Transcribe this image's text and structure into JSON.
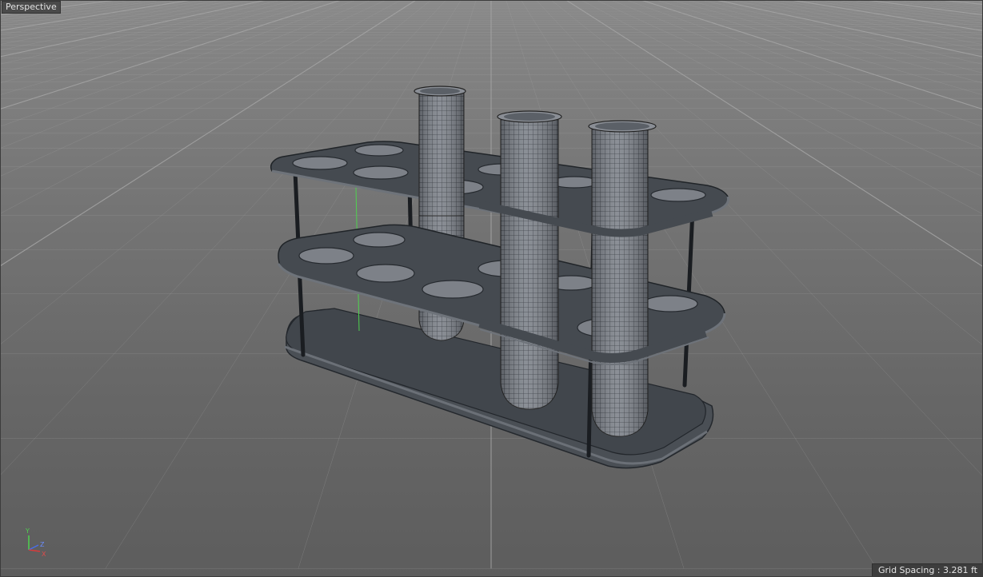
{
  "viewport": {
    "label": "Perspective",
    "grid_spacing": "Grid Spacing : 3.281 ft"
  },
  "axis_gizmo": {
    "y": "Y",
    "z": "Z",
    "x": "X"
  },
  "colors": {
    "grid_line": "#a4a4a4",
    "object_fill": "#454a50",
    "tube_fill": "#7b8088",
    "wire": "#262a30",
    "axis_x": "#d83a3a",
    "axis_y": "#4fd24f",
    "axis_z": "#4a6ee8"
  }
}
